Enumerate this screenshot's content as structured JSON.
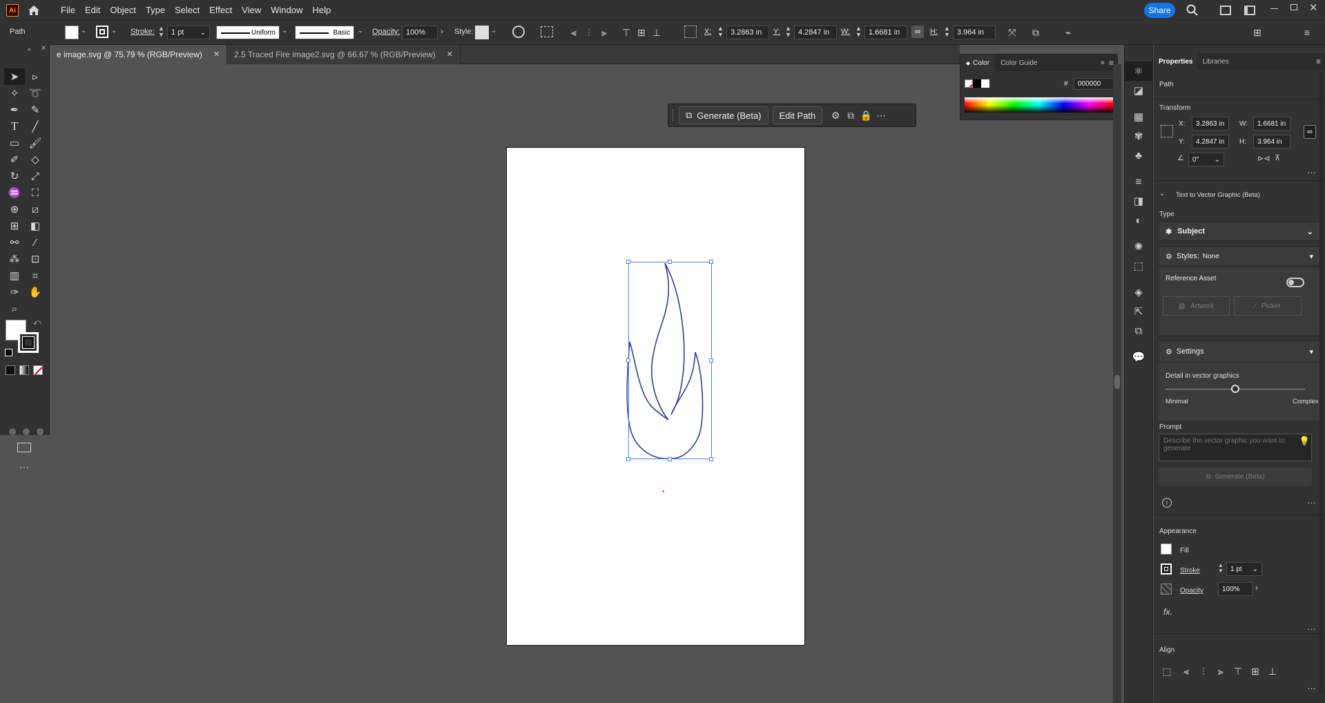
{
  "app": {
    "logo": "Ai"
  },
  "menu": [
    "File",
    "Edit",
    "Object",
    "Type",
    "Select",
    "Effect",
    "View",
    "Window",
    "Help"
  ],
  "share_label": "Share",
  "control": {
    "object_type": "Path",
    "stroke_label": "Stroke:",
    "stroke_value": "1 pt",
    "profile": "Uniform",
    "brush": "Basic",
    "opacity_label": "Opacity:",
    "opacity_value": "100%",
    "style_label": "Style:",
    "x_label": "X:",
    "x_value": "3.2863 in",
    "y_label": "Y:",
    "y_value": "4.2847 in",
    "w_label": "W:",
    "w_value": "1.6681 in",
    "h_label": "H:",
    "h_value": "3.964 in"
  },
  "tabs": [
    {
      "label": "e image.svg @ 75.79 % (RGB/Preview)",
      "active": true
    },
    {
      "label": "2.5 Traced Fire image2.svg @ 66.67 % (RGB/Preview)",
      "active": false
    }
  ],
  "context_bar": {
    "generate": "Generate (Beta)",
    "edit_path": "Edit Path"
  },
  "color_panel": {
    "tab_color": "Color",
    "tab_guide": "Color Guide",
    "hex_symbol": "#",
    "hex_value": "000000"
  },
  "properties": {
    "tab_properties": "Properties",
    "tab_libraries": "Libraries",
    "object_type": "Path",
    "transform_title": "Transform",
    "x_label": "X:",
    "x_value": "3.2863 in",
    "y_label": "Y:",
    "y_value": "4.2847 in",
    "w_label": "W:",
    "w_value": "1.6681 in",
    "h_label": "H:",
    "h_value": "3.964 in",
    "angle_value": "0°",
    "t2v_title": "Text to Vector Graphic (Beta)",
    "type_label": "Type",
    "type_value": "Subject",
    "styles_label": "Styles:",
    "styles_value": "None",
    "reference_asset": "Reference Asset",
    "artwork_btn": "Artwork",
    "picker_btn": "Picker",
    "settings": "Settings",
    "detail_label": "Detail in vector graphics",
    "detail_min": "Minimal",
    "detail_max": "Complex",
    "detail_level": 0.5,
    "prompt_label": "Prompt",
    "prompt_placeholder": "Describe the vector graphic you want to generate",
    "generate_btn": "Generate (Beta)",
    "appearance_title": "Appearance",
    "fill_label": "Fill",
    "stroke_label": "Stroke",
    "stroke_value": "1 pt",
    "opacity_label": "Opacity",
    "opacity_value": "100%",
    "fx_label": "fx.",
    "align_title": "Align"
  },
  "colors": {
    "accent": "#1473e6",
    "flame_stroke": "#2c3f99",
    "selection": "#4a7cff"
  }
}
